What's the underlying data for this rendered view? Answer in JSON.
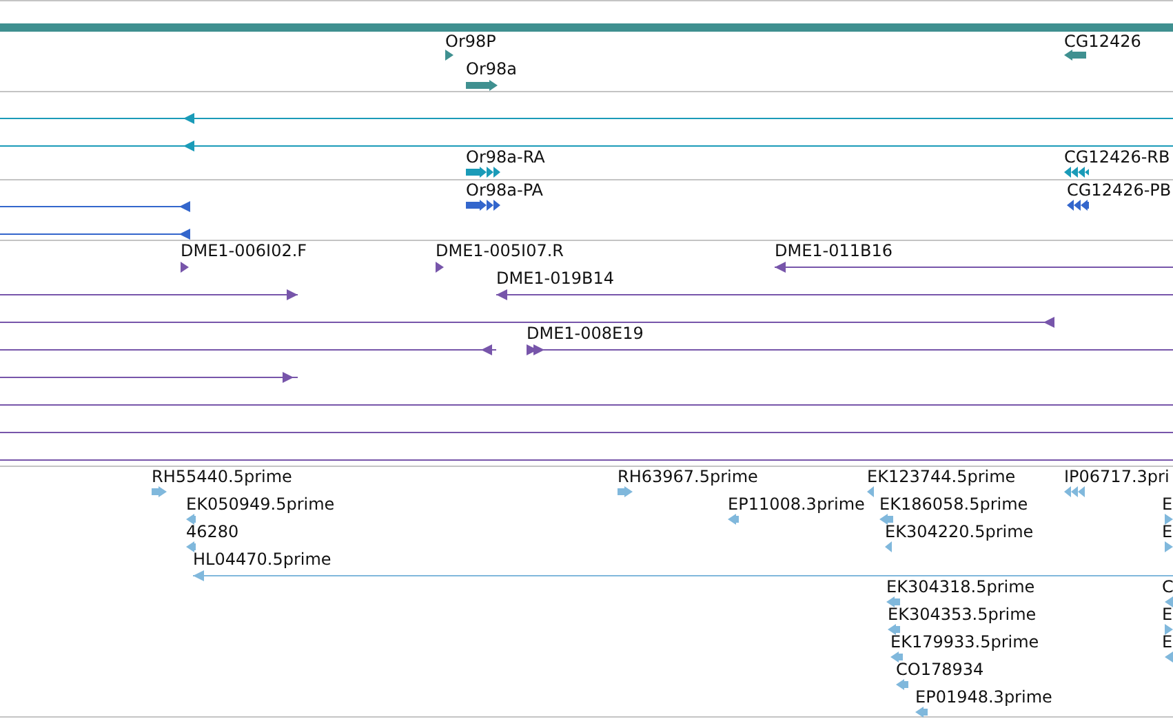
{
  "tracks": [
    {
      "color": "#3f9090",
      "features": [
        {
          "kind": "bar"
        },
        {
          "kind": "block",
          "label": "Or98P",
          "reverse": false
        },
        {
          "kind": "block",
          "label": "Or98a",
          "reverse": false
        },
        {
          "kind": "block",
          "label": "CG12426",
          "reverse": true
        }
      ]
    },
    {
      "color": "#1a9bb8",
      "features": [
        {
          "kind": "line",
          "reverse": true
        },
        {
          "kind": "line",
          "reverse": true
        },
        {
          "kind": "block",
          "label": "Or98a-RA",
          "reverse": false
        },
        {
          "kind": "block",
          "label": "CG12426-RB",
          "reverse": true
        }
      ]
    },
    {
      "color": "#3366cc",
      "features": [
        {
          "kind": "block",
          "label": "Or98a-PA",
          "reverse": false
        },
        {
          "kind": "block",
          "label": "CG12426-PB",
          "reverse": true
        },
        {
          "kind": "line",
          "reverse": true
        },
        {
          "kind": "line",
          "reverse": true
        }
      ]
    },
    {
      "color": "#7755aa",
      "features": [
        {
          "kind": "block",
          "label": "DME1-006I02.F",
          "reverse": false
        },
        {
          "kind": "block",
          "label": "DME1-005I07.R",
          "reverse": false
        },
        {
          "kind": "line",
          "label": "DME1-011B16",
          "reverse": true
        },
        {
          "kind": "line",
          "reverse": false
        },
        {
          "kind": "line",
          "label": "DME1-019B14",
          "reverse": true
        },
        {
          "kind": "line",
          "reverse": true
        },
        {
          "kind": "line",
          "reverse": true
        },
        {
          "kind": "line",
          "label": "DME1-008E19",
          "reverse": false
        },
        {
          "kind": "line",
          "reverse": false
        },
        {
          "kind": "line"
        },
        {
          "kind": "line"
        },
        {
          "kind": "line"
        }
      ]
    },
    {
      "color": "#80b8dc",
      "features": [
        {
          "kind": "block",
          "label": "RH55440.5prime",
          "reverse": false
        },
        {
          "kind": "block",
          "label": "EK050949.5prime",
          "reverse": true
        },
        {
          "kind": "block",
          "label": "46280",
          "reverse": true
        },
        {
          "kind": "line",
          "label": "HL04470.5prime",
          "reverse": true
        },
        {
          "kind": "block",
          "label": "RH63967.5prime",
          "reverse": false
        },
        {
          "kind": "block",
          "label": "EP11008.3prime",
          "reverse": true
        },
        {
          "kind": "block",
          "label": "EK123744.5prime",
          "reverse": true
        },
        {
          "kind": "block",
          "label": "EK186058.5prime",
          "reverse": true
        },
        {
          "kind": "block",
          "label": "EK304220.5prime",
          "reverse": true
        },
        {
          "kind": "block",
          "label": "IP06717.3pri",
          "reverse": true
        },
        {
          "kind": "block",
          "label": "E",
          "reverse": false
        },
        {
          "kind": "block",
          "label": "E",
          "reverse": false
        },
        {
          "kind": "block",
          "label": "EK304318.5prime",
          "reverse": true
        },
        {
          "kind": "block",
          "label": "EK304353.5prime",
          "reverse": true
        },
        {
          "kind": "block",
          "label": "EK179933.5prime",
          "reverse": true
        },
        {
          "kind": "block",
          "label": "CO178934",
          "reverse": true
        },
        {
          "kind": "block",
          "label": "EP01948.3prime",
          "reverse": true
        },
        {
          "kind": "block",
          "label": "C",
          "reverse": true
        },
        {
          "kind": "block",
          "label": "E",
          "reverse": false
        },
        {
          "kind": "block",
          "label": "E",
          "reverse": true
        }
      ]
    }
  ]
}
